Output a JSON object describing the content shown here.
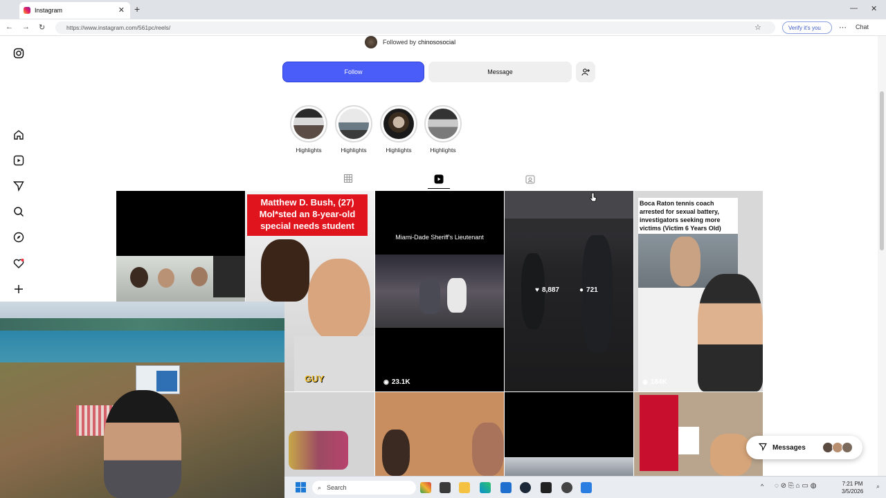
{
  "browser": {
    "tab_title": "Instagram",
    "url": "https://www.instagram.com/561pc/reels/",
    "verify_label": "Verify it's you",
    "chat_label": "Chat"
  },
  "profile": {
    "followed_by_prefix": "Followed by",
    "followed_by_user": "chinososocial",
    "follow_label": "Follow",
    "message_label": "Message",
    "highlights": [
      {
        "label": "Highlights"
      },
      {
        "label": "Highlights"
      },
      {
        "label": "Highlights"
      },
      {
        "label": "Highlights"
      }
    ]
  },
  "grid": {
    "tile2_caption": "Matthew D. Bush, (27) Mol*sted an 8-year-old special needs student",
    "tile2_bottom_text": "GUY",
    "tile3_title": "Miami-Dade Sheriff's Lieutenant",
    "tile3_views": "23.1K",
    "tile4_likes": "8,887",
    "tile4_comments": "721",
    "tile5_caption_a": "Boca Raton tennis coach arrested for sexual battery, investigators seeking more victims",
    "tile5_caption_b": "(Victim 6 Years Old)",
    "tile5_views": "184K"
  },
  "messages": {
    "label": "Messages"
  },
  "taskbar": {
    "search_placeholder": "Search",
    "time": "7:21 PM",
    "date": "3/5/2026"
  },
  "colors": {
    "follow_blue": "#4a5df9",
    "instagram_gradient": "#e91e63"
  }
}
